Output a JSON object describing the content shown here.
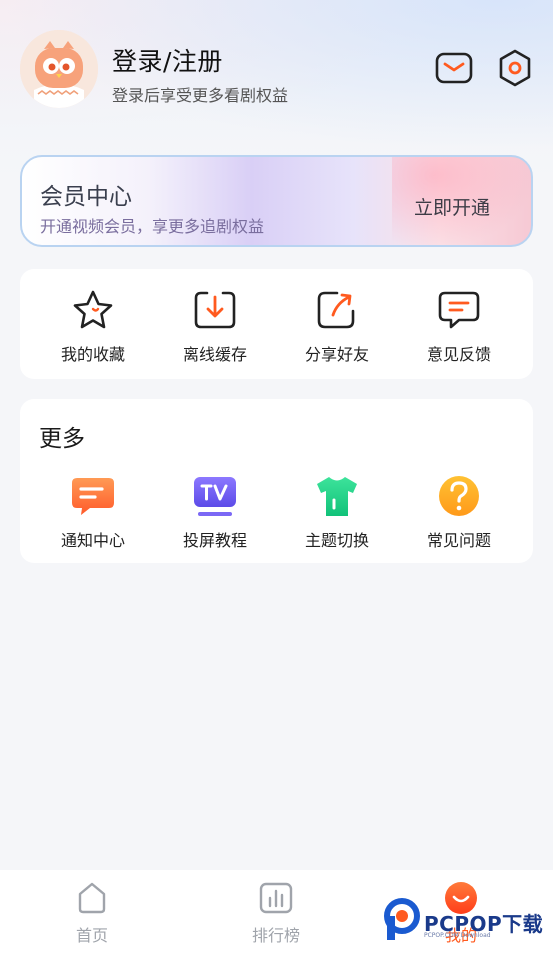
{
  "header": {
    "title": "登录/注册",
    "subtitle": "登录后享受更多看剧权益",
    "icons": [
      "mail-icon",
      "settings-icon"
    ]
  },
  "vip": {
    "title": "会员中心",
    "subtitle": "开通视频会员，享更多追剧权益",
    "button_label": "立即开通"
  },
  "quick_actions": [
    {
      "label": "我的收藏",
      "icon": "star-icon"
    },
    {
      "label": "离线缓存",
      "icon": "download-icon"
    },
    {
      "label": "分享好友",
      "icon": "share-icon"
    },
    {
      "label": "意见反馈",
      "icon": "feedback-icon"
    }
  ],
  "more": {
    "title": "更多",
    "items": [
      {
        "label": "通知中心",
        "icon": "notification-icon"
      },
      {
        "label": "投屏教程",
        "icon": "tv-cast-icon"
      },
      {
        "label": "主题切换",
        "icon": "theme-shirt-icon"
      },
      {
        "label": "常见问题",
        "icon": "faq-icon"
      }
    ]
  },
  "bottom_nav": [
    {
      "label": "首页",
      "icon": "home-icon",
      "active": false
    },
    {
      "label": "排行榜",
      "icon": "ranking-icon",
      "active": false
    },
    {
      "label": "我的",
      "icon": "profile-icon",
      "active": true
    }
  ],
  "watermark": {
    "brand": "PCPOP下载",
    "sub": "PCPOP.COM Download"
  },
  "colors": {
    "accent": "#ff5a1f",
    "nav_inactive": "#a0a4ab",
    "card_border": "#b9d3f1"
  }
}
